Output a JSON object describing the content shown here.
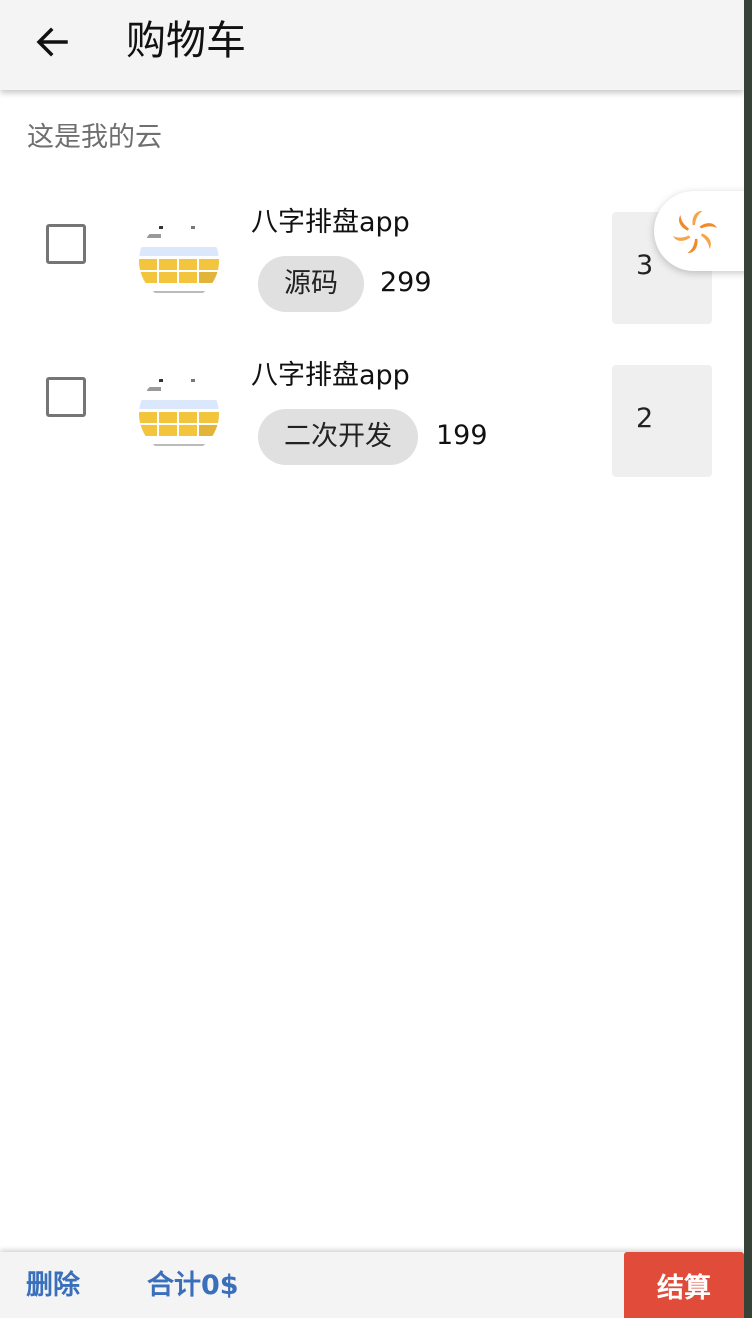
{
  "appbar": {
    "title": "购物车"
  },
  "subtitle": "这是我的云",
  "cart": {
    "items": [
      {
        "name": "八字排盘app",
        "tag": "源码",
        "price": "299",
        "quantity": "3",
        "checked": false
      },
      {
        "name": "八字排盘app",
        "tag": "二次开发",
        "price": "199",
        "quantity": "2",
        "checked": false
      }
    ]
  },
  "footer": {
    "delete_label": "删除",
    "total_label": "合计0$",
    "checkout_label": "结算"
  },
  "colors": {
    "accent": "#3a6fbb",
    "checkout": "#e14b3a",
    "appbar_bg": "#f4f4f4",
    "chip_bg": "#e0e0e0"
  },
  "icons": {
    "back": "arrow-left-icon",
    "floating": "swirl-logo-icon"
  }
}
